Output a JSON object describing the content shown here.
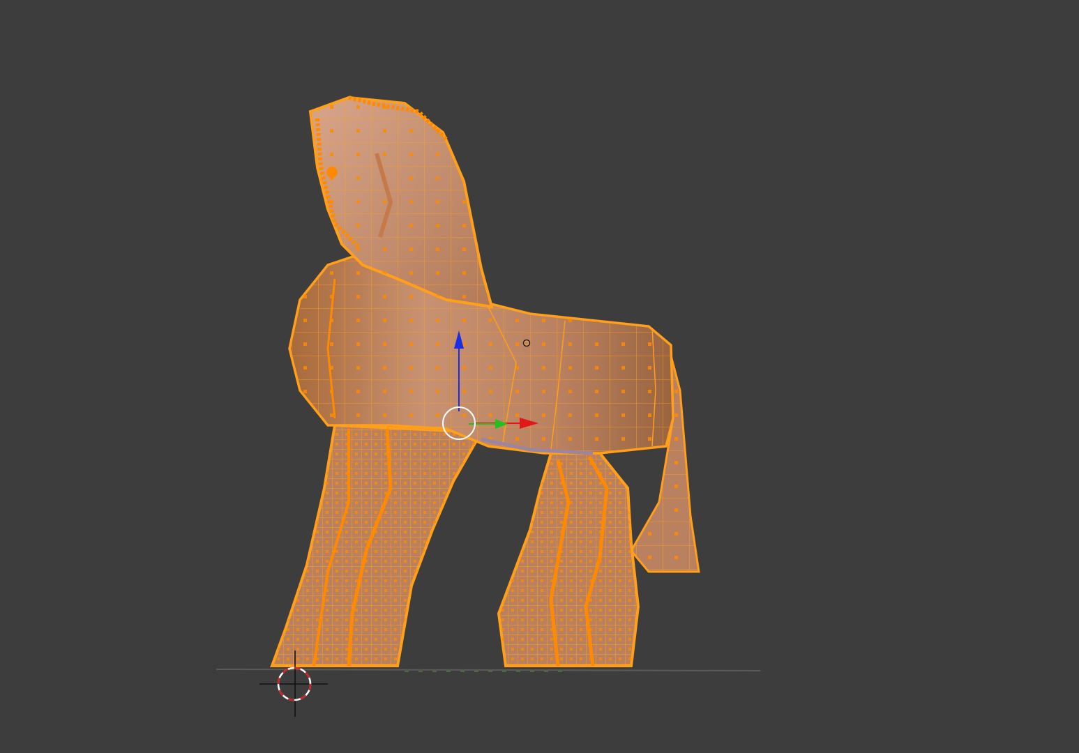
{
  "viewport": {
    "background": "#3d3d3d",
    "editor_mode": "edit-mode",
    "shading": "solid-with-wireframe-overlay"
  },
  "mesh": {
    "object": "horse-statue",
    "selection_state": "all-vertices-selected",
    "surface_color": "#c8906a",
    "wire_color": "#ff9f1a",
    "vertex_color": "#ff8a00"
  },
  "gizmo": {
    "type": "translate",
    "axes": [
      {
        "axis": "x",
        "color": "#e01818"
      },
      {
        "axis": "y",
        "color": "#22c020"
      },
      {
        "axis": "z",
        "color": "#1a2ee6"
      }
    ]
  },
  "cursor_3d": {
    "icon": "3d-cursor-icon",
    "ring_colors": [
      "#ffffff",
      "#d02020"
    ]
  },
  "grid_floor": {
    "color": "#5a5a5a"
  }
}
